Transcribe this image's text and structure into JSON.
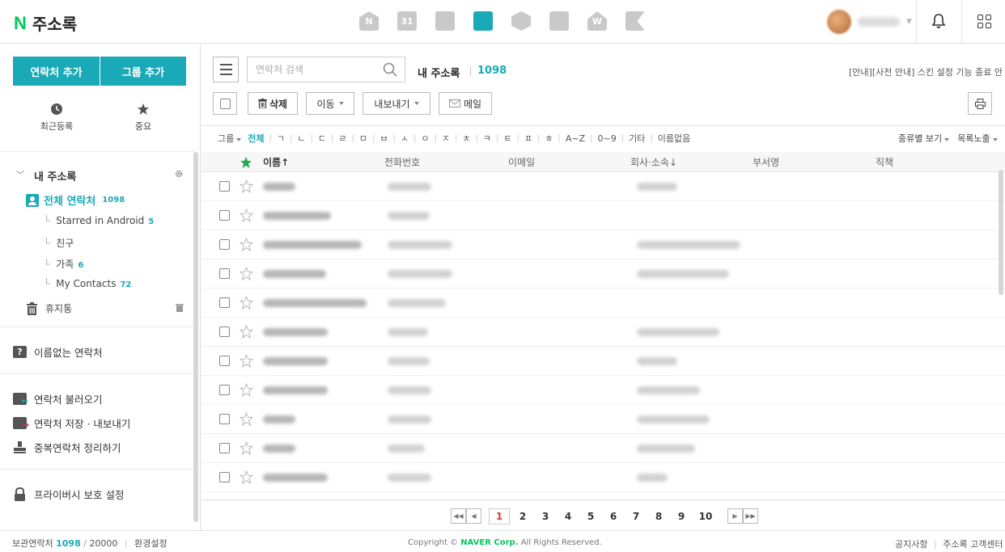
{
  "header": {
    "logo_mark": "N",
    "logo_title": "주소록",
    "apps": [
      {
        "name": "mail-app",
        "glyph": "N"
      },
      {
        "name": "calendar-app",
        "glyph": "31"
      },
      {
        "name": "memo-app",
        "glyph": ""
      },
      {
        "name": "contacts-app",
        "glyph": ""
      },
      {
        "name": "mybox-app",
        "glyph": ""
      },
      {
        "name": "office-app",
        "glyph": ""
      },
      {
        "name": "works-app",
        "glyph": "W"
      },
      {
        "name": "bookmark-app",
        "glyph": ""
      }
    ]
  },
  "sidebar": {
    "add_contact": "연락처 추가",
    "add_group": "그룹 추가",
    "recent": "최근등록",
    "important": "중요",
    "tree_title": "내 주소록",
    "all_contacts": "전체 연락처",
    "all_count": "1098",
    "groups": [
      {
        "label": "Starred in Android",
        "count": "5"
      },
      {
        "label": "친구",
        "count": ""
      },
      {
        "label": "가족",
        "count": "6"
      },
      {
        "label": "My Contacts",
        "count": "72"
      }
    ],
    "trash": "휴지통",
    "no_name": "이름없는 연락처",
    "import": "연락처 불러오기",
    "export": "연락처 저장 · 내보내기",
    "dedupe": "중복연락처 정리하기",
    "privacy": "프라이버시 보호 설정"
  },
  "main": {
    "search_placeholder": "연락처 검색",
    "title": "내 주소록",
    "count": "1098",
    "notice": "[안내][사전 안내] 스킨 설정 기능 종료 안",
    "toolbar": {
      "delete": "삭제",
      "move": "이동",
      "export": "내보내기",
      "mail": "메일"
    },
    "filters": {
      "group": "그룹",
      "items": [
        "전체",
        "ㄱ",
        "ㄴ",
        "ㄷ",
        "ㄹ",
        "ㅁ",
        "ㅂ",
        "ㅅ",
        "ㅇ",
        "ㅈ",
        "ㅊ",
        "ㅋ",
        "ㅌ",
        "ㅍ",
        "ㅎ",
        "A~Z",
        "0~9",
        "기타",
        "이름없음"
      ],
      "view_by_type": "종류별 보기",
      "list_display": "목록노출"
    },
    "columns": {
      "name": "이름↑",
      "phone": "전화번호",
      "email": "이메일",
      "company": "회사·소속↓",
      "dept": "부서명",
      "title": "직책"
    },
    "rows": [
      {
        "name_w": 40,
        "phone_w": 54,
        "co_w": 50
      },
      {
        "name_w": 84,
        "phone_w": 52,
        "co_w": 0
      },
      {
        "name_w": 122,
        "phone_w": 80,
        "co_w": 128
      },
      {
        "name_w": 78,
        "phone_w": 80,
        "co_w": 114
      },
      {
        "name_w": 128,
        "phone_w": 72,
        "co_w": 0
      },
      {
        "name_w": 80,
        "phone_w": 50,
        "co_w": 102
      },
      {
        "name_w": 80,
        "phone_w": 52,
        "co_w": 50
      },
      {
        "name_w": 80,
        "phone_w": 54,
        "co_w": 78
      },
      {
        "name_w": 40,
        "phone_w": 54,
        "co_w": 90
      },
      {
        "name_w": 40,
        "phone_w": 46,
        "co_w": 72
      },
      {
        "name_w": 80,
        "phone_w": 54,
        "co_w": 38
      }
    ],
    "pages": [
      "1",
      "2",
      "3",
      "4",
      "5",
      "6",
      "7",
      "8",
      "9",
      "10"
    ],
    "current_page": "1"
  },
  "footer": {
    "storage_label": "보관연락처",
    "storage_used": "1098",
    "storage_total": "20000",
    "settings": "환경설정",
    "copyright_pre": "Copyright ©",
    "copyright_brand": "NAVER Corp.",
    "copyright_post": "All Rights Reserved.",
    "notice": "공지사항",
    "help": "주소록 고객센터"
  },
  "colors": {
    "accent": "#1aa9b7",
    "naver_green": "#03c75a",
    "current_page": "#e0392b"
  }
}
